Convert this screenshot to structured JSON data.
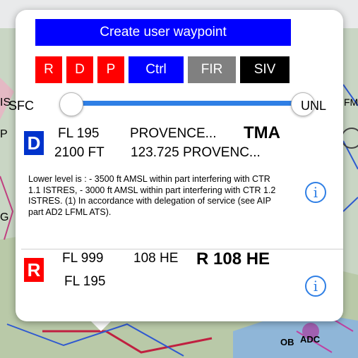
{
  "popup": {
    "title_button": "Create user waypoint",
    "filter_chips": [
      {
        "label": "R",
        "color": "#ff0000"
      },
      {
        "label": "D",
        "color": "#ff0000"
      },
      {
        "label": "P",
        "color": "#ff0000"
      },
      {
        "label": "Ctrl",
        "color": "#0000ff"
      },
      {
        "label": "FIR",
        "color": "#808080"
      },
      {
        "label": "SIV",
        "color": "#000000"
      }
    ],
    "altitude_range": {
      "min_label": "SFC",
      "max_label": "UNL"
    },
    "results": [
      {
        "badge": "D",
        "badge_color": "#0033cc",
        "upper_limit": "FL 195",
        "lower_limit": "2100 FT",
        "name": "PROVENCE...",
        "frequency": "123.725 PROVENC...",
        "type": "TMA",
        "notes": "Lower level is : - 3500 ft AMSL within part interfering with CTR 1.1 ISTRES, - 3000 ft AMSL within part interfering with CTR 1.2 ISTRES. (1) In accordance with delegation of service (see AIP part AD2 LFML ATS).",
        "info_icon": "info-icon"
      },
      {
        "badge": "R",
        "badge_color": "#ff0000",
        "upper_limit": "FL 999",
        "lower_limit": "FL 195",
        "name": "108 HE",
        "type": "R 108 HE",
        "info_icon": "info-icon"
      }
    ]
  },
  "map": {
    "labels": {
      "left_a": "IS",
      "left_b": "P",
      "left_c": "G",
      "right_fm": "FM",
      "bottom_ob": "OB",
      "bottom_adc": "ADC"
    }
  }
}
